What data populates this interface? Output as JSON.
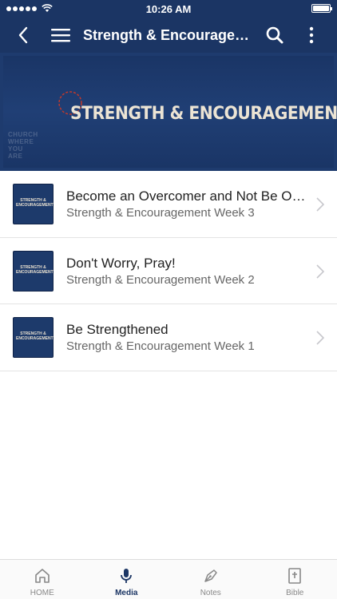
{
  "status_bar": {
    "time": "10:26 AM"
  },
  "nav": {
    "title": "Strength & Encouragem..."
  },
  "banner": {
    "title": "STRENGTH & ENCOURAGEMENT",
    "thumb_text": "STRENGTH & ENCOURAGEMENT"
  },
  "items": [
    {
      "title": "Become an Overcomer and Not Be Ov...",
      "subtitle": "Strength & Encouragement Week 3",
      "thumb_text": "STRENGTH & ENCOURAGEMENT"
    },
    {
      "title": "Don't Worry, Pray!",
      "subtitle": "Strength & Encouragement Week 2",
      "thumb_text": "STRENGTH & ENCOURAGEMENT"
    },
    {
      "title": "Be Strengthened",
      "subtitle": "Strength & Encouragement Week 1",
      "thumb_text": "STRENGTH & ENCOURAGEMENT"
    }
  ],
  "tabs": [
    {
      "label": "HOME",
      "icon": "home-icon"
    },
    {
      "label": "Media",
      "icon": "microphone-icon",
      "active": true
    },
    {
      "label": "Notes",
      "icon": "pen-icon"
    },
    {
      "label": "Bible",
      "icon": "bible-icon"
    }
  ],
  "colors": {
    "brand": "#1b3564",
    "accent_red": "#c0392b",
    "banner_text": "#ece4d4"
  }
}
